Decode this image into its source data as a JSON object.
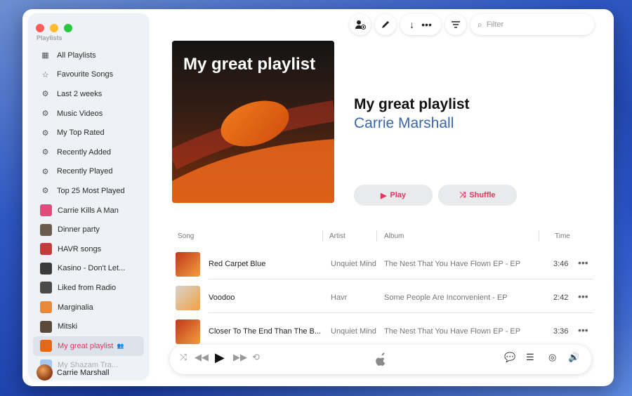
{
  "sidebar": {
    "heading": "Playlists",
    "items": [
      {
        "label": "All Playlists",
        "icon": "grid-icon",
        "type": "icon"
      },
      {
        "label": "Favourite Songs",
        "icon": "star-icon",
        "type": "icon"
      },
      {
        "label": "Last 2 weeks",
        "icon": "gear-icon",
        "type": "icon"
      },
      {
        "label": "Music Videos",
        "icon": "gear-icon",
        "type": "icon"
      },
      {
        "label": "My Top Rated",
        "icon": "gear-icon",
        "type": "icon"
      },
      {
        "label": "Recently Added",
        "icon": "gear-icon",
        "type": "icon"
      },
      {
        "label": "Recently Played",
        "icon": "gear-icon",
        "type": "icon"
      },
      {
        "label": "Top 25 Most Played",
        "icon": "gear-icon",
        "type": "icon"
      },
      {
        "label": "Carrie Kills A Man",
        "type": "thumb",
        "color": "#e04b7c"
      },
      {
        "label": "Dinner party",
        "type": "thumb",
        "color": "#6b5a4e"
      },
      {
        "label": "HAVR songs",
        "type": "thumb",
        "color": "#c53a3a"
      },
      {
        "label": "Kasino - Don't Let...",
        "type": "thumb",
        "color": "#3a3a3a"
      },
      {
        "label": "Liked from Radio",
        "type": "thumb",
        "color": "#4a4a4a"
      },
      {
        "label": "Marginalia",
        "type": "thumb",
        "color": "#e88a3a"
      },
      {
        "label": "Mitski",
        "type": "thumb",
        "color": "#5a4a3a"
      },
      {
        "label": "My great playlist",
        "type": "thumb",
        "color": "#e06a1a",
        "active": true
      },
      {
        "label": "My Shazam Tra...",
        "type": "thumb",
        "color": "#2a7ae0",
        "faded": true
      }
    ],
    "user_name": "Carrie Marshall"
  },
  "toolbar": {
    "filter_placeholder": "Filter"
  },
  "playlist": {
    "cover_title": "My great playlist",
    "title": "My great playlist",
    "owner": "Carrie Marshall",
    "play_label": "Play",
    "shuffle_label": "Shuffle"
  },
  "table": {
    "headers": {
      "song": "Song",
      "artist": "Artist",
      "album": "Album",
      "time": "Time"
    },
    "rows": [
      {
        "song": "Red Carpet Blue",
        "artist": "Unquiet Mind",
        "album": "The Nest That You Have Flown EP - EP",
        "time": "3:46",
        "art": "#c4361b"
      },
      {
        "song": "Voodoo",
        "artist": "Havr",
        "album": "Some People Are Inconvenient - EP",
        "time": "2:42",
        "art": "#d9d3cf"
      },
      {
        "song": "Closer To The End Than The B...",
        "artist": "Unquiet Mind",
        "album": "The Nest That You Have Flown EP - EP",
        "time": "3:36",
        "art": "#c4361b"
      }
    ]
  },
  "colors": {
    "accent": "#e8345e",
    "owner_link": "#3a67a8"
  }
}
